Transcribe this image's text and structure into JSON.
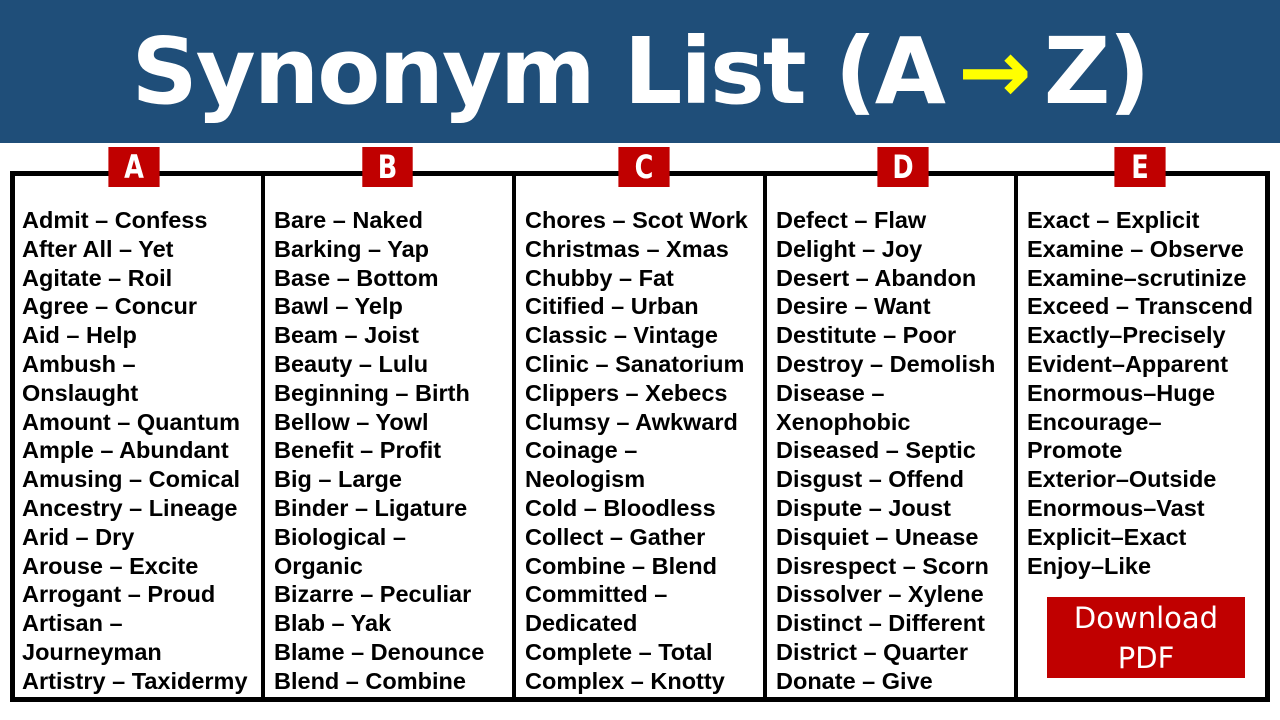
{
  "header": {
    "title_left": "Synonym List (A",
    "arrow_icon": "→",
    "title_right": "Z)",
    "background_color": "#1f4e79",
    "arrow_color": "#ffff00"
  },
  "accent_color": "#c00000",
  "columns": [
    {
      "letter": "A",
      "entries": [
        "Admit – Confess",
        "After All – Yet",
        "Agitate – Roil",
        "Agree – Concur",
        "Aid – Help",
        "Ambush –",
        "Onslaught",
        "Amount – Quantum",
        "Ample – Abundant",
        "Amusing – Comical",
        "Ancestry – Lineage",
        "Arid – Dry",
        "Arouse – Excite",
        "Arrogant – Proud",
        "Artisan –",
        "Journeyman",
        "Artistry – Taxidermy"
      ]
    },
    {
      "letter": "B",
      "entries": [
        "Bare – Naked",
        "Barking – Yap",
        "Base – Bottom",
        "Bawl – Yelp",
        "Beam – Joist",
        "Beauty – Lulu",
        "Beginning – Birth",
        "Bellow – Yowl",
        "Benefit – Profit",
        "Big – Large",
        "Binder – Ligature",
        "Biological –",
        "Organic",
        "Bizarre – Peculiar",
        "Blab – Yak",
        "Blame – Denounce",
        "Blend – Combine"
      ]
    },
    {
      "letter": "C",
      "entries": [
        "Chores – Scot Work",
        "Christmas – Xmas",
        "Chubby – Fat",
        "Citified – Urban",
        "Classic – Vintage",
        "Clinic – Sanatorium",
        "Clippers – Xebecs",
        "Clumsy – Awkward",
        "Coinage –",
        "Neologism",
        "Cold – Bloodless",
        "Collect – Gather",
        "Combine – Blend",
        "Committed –",
        "Dedicated",
        "Complete – Total",
        "Complex – Knotty"
      ]
    },
    {
      "letter": "D",
      "entries": [
        "Defect – Flaw",
        "Delight – Joy",
        "Desert – Abandon",
        "Desire – Want",
        "Destitute – Poor",
        "Destroy – Demolish",
        "Disease –",
        "Xenophobic",
        "Diseased – Septic",
        "Disgust – Offend",
        "Dispute – Joust",
        "Disquiet – Unease",
        "Disrespect – Scorn",
        "Dissolver – Xylene",
        "Distinct – Different",
        "District – Quarter",
        "Donate – Give"
      ]
    },
    {
      "letter": "E",
      "entries": [
        "Exact – Explicit",
        "Examine – Observe",
        "Examine–scrutinize",
        "Exceed – Transcend",
        "Exactly–Precisely",
        "Evident–Apparent",
        "Enormous–Huge",
        "Encourage–",
        "Promote",
        "Exterior–Outside",
        "Enormous–Vast",
        "Explicit–Exact",
        "Enjoy–Like"
      ]
    }
  ],
  "download_button": {
    "line1": "Download",
    "line2": "PDF"
  }
}
